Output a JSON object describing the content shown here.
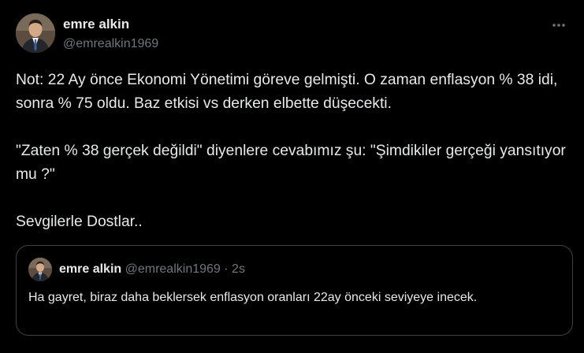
{
  "author": {
    "display_name": "emre alkin",
    "handle": "@emrealkin1969",
    "avatar": "profile-photo"
  },
  "tweet": {
    "paragraphs": [
      "Not: 22 Ay önce Ekonomi Yönetimi göreve gelmişti. O zaman enflasyon % 38 idi, sonra % 75 oldu. Baz etkisi vs derken elbette düşecekti.",
      "\"Zaten % 38 gerçek değildi\" diyenlere cevabımız şu: \"Şimdikiler gerçeği yansıtıyor mu ?\"",
      "Sevgilerle Dostlar.."
    ]
  },
  "quoted_tweet": {
    "display_name": "emre alkin",
    "handle": "@emrealkin1969",
    "separator": "·",
    "timestamp": "2s",
    "text": "Ha gayret, biraz daha beklersek enflasyon oranları 22ay önceki seviyeye inecek."
  },
  "icons": {
    "more": "more-horizontal-icon"
  },
  "colors": {
    "background": "#000000",
    "text_primary": "#e7e9ea",
    "text_secondary": "#71767b",
    "border": "#3e4144"
  }
}
